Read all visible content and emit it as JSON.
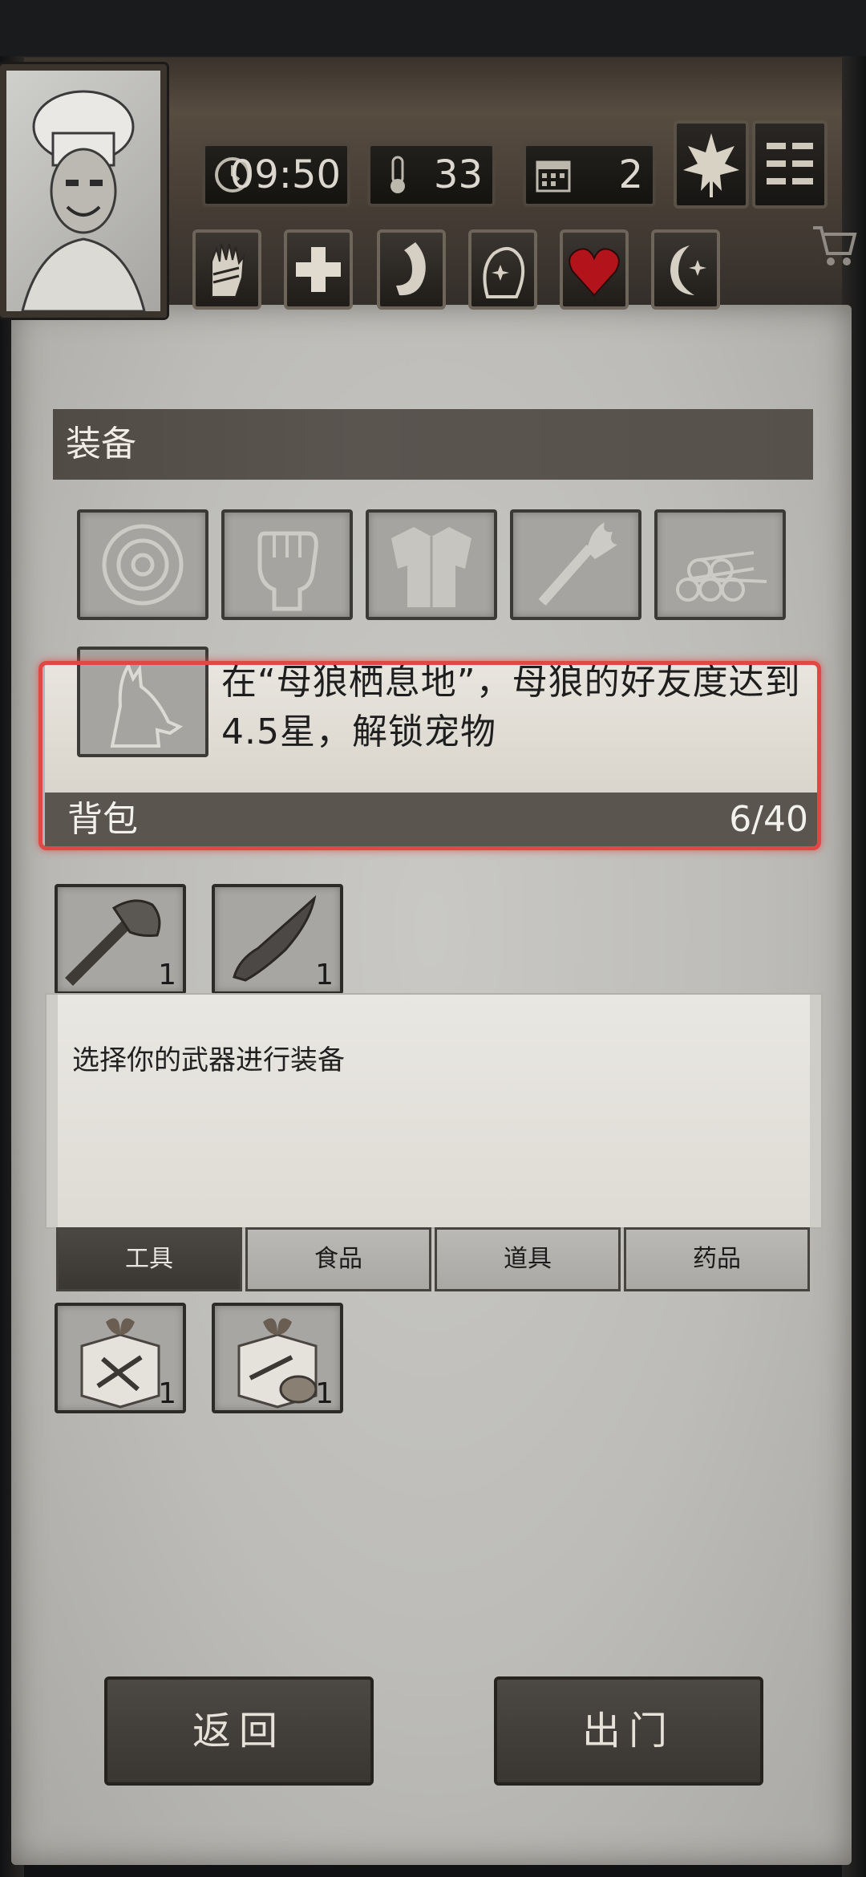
{
  "status_bar": {
    "time": "09:50",
    "temperature": "33",
    "day": "2"
  },
  "equipment": {
    "header": "装备",
    "pet_unlock_hint": "在“母狼栖息地”，母狼的好友度达到4.5星，解锁宠物"
  },
  "backpack": {
    "header": "背包",
    "count": "6/40",
    "items": [
      {
        "name": "stone-axe",
        "qty": "1"
      },
      {
        "name": "stone-spear",
        "qty": "1"
      }
    ]
  },
  "description": "选择你的武器进行装备",
  "tabs": [
    "工具",
    "食品",
    "道具",
    "药品"
  ],
  "active_tab": "工具",
  "tool_items": [
    {
      "name": "gift-box-tools",
      "qty": "1"
    },
    {
      "name": "gift-box-wood",
      "qty": "1"
    }
  ],
  "buttons": {
    "back": "返回",
    "go_out": "出门"
  },
  "colors": {
    "highlight": "#e04846",
    "heart": "#b3141c"
  }
}
